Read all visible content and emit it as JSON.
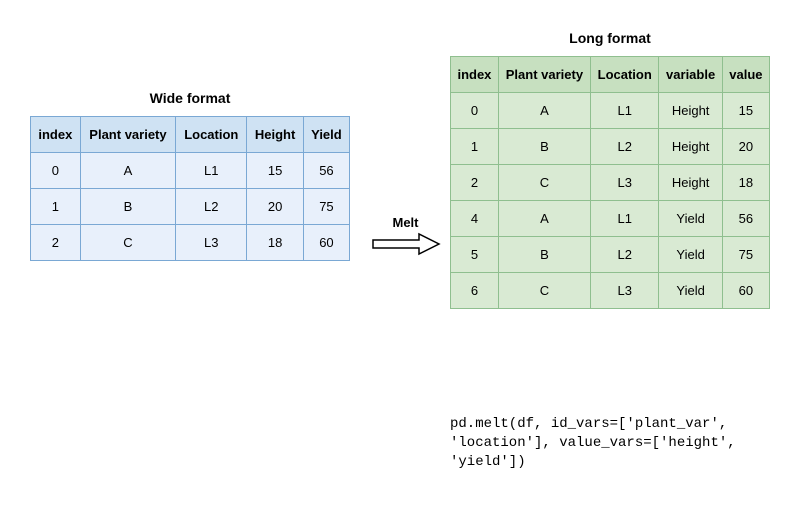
{
  "wide": {
    "title": "Wide format",
    "headers": [
      "index",
      "Plant variety",
      "Location",
      "Height",
      "Yield"
    ],
    "rows": [
      [
        "0",
        "A",
        "L1",
        "15",
        "56"
      ],
      [
        "1",
        "B",
        "L2",
        "20",
        "75"
      ],
      [
        "2",
        "C",
        "L3",
        "18",
        "60"
      ]
    ]
  },
  "long": {
    "title": "Long format",
    "headers": [
      "index",
      "Plant variety",
      "Location",
      "variable",
      "value"
    ],
    "rows": [
      [
        "0",
        "A",
        "L1",
        "Height",
        "15"
      ],
      [
        "1",
        "B",
        "L2",
        "Height",
        "20"
      ],
      [
        "2",
        "C",
        "L3",
        "Height",
        "18"
      ],
      [
        "4",
        "A",
        "L1",
        "Yield",
        "56"
      ],
      [
        "5",
        "B",
        "L2",
        "Yield",
        "75"
      ],
      [
        "6",
        "C",
        "L3",
        "Yield",
        "60"
      ]
    ]
  },
  "melt_label": "Melt",
  "code": "pd.melt(df, id_vars=['plant_var', 'location'], value_vars=['height', 'yield'])",
  "chart_data": {
    "type": "table",
    "operation": "melt",
    "wide": {
      "columns": [
        "index",
        "Plant variety",
        "Location",
        "Height",
        "Yield"
      ],
      "data": [
        [
          0,
          "A",
          "L1",
          15,
          56
        ],
        [
          1,
          "B",
          "L2",
          20,
          75
        ],
        [
          2,
          "C",
          "L3",
          18,
          60
        ]
      ]
    },
    "long": {
      "columns": [
        "index",
        "Plant variety",
        "Location",
        "variable",
        "value"
      ],
      "data": [
        [
          0,
          "A",
          "L1",
          "Height",
          15
        ],
        [
          1,
          "B",
          "L2",
          "Height",
          20
        ],
        [
          2,
          "C",
          "L3",
          "Height",
          18
        ],
        [
          4,
          "A",
          "L1",
          "Yield",
          56
        ],
        [
          5,
          "B",
          "L2",
          "Yield",
          75
        ],
        [
          6,
          "C",
          "L3",
          "Yield",
          60
        ]
      ]
    },
    "id_vars": [
      "plant_var",
      "location"
    ],
    "value_vars": [
      "height",
      "yield"
    ]
  }
}
